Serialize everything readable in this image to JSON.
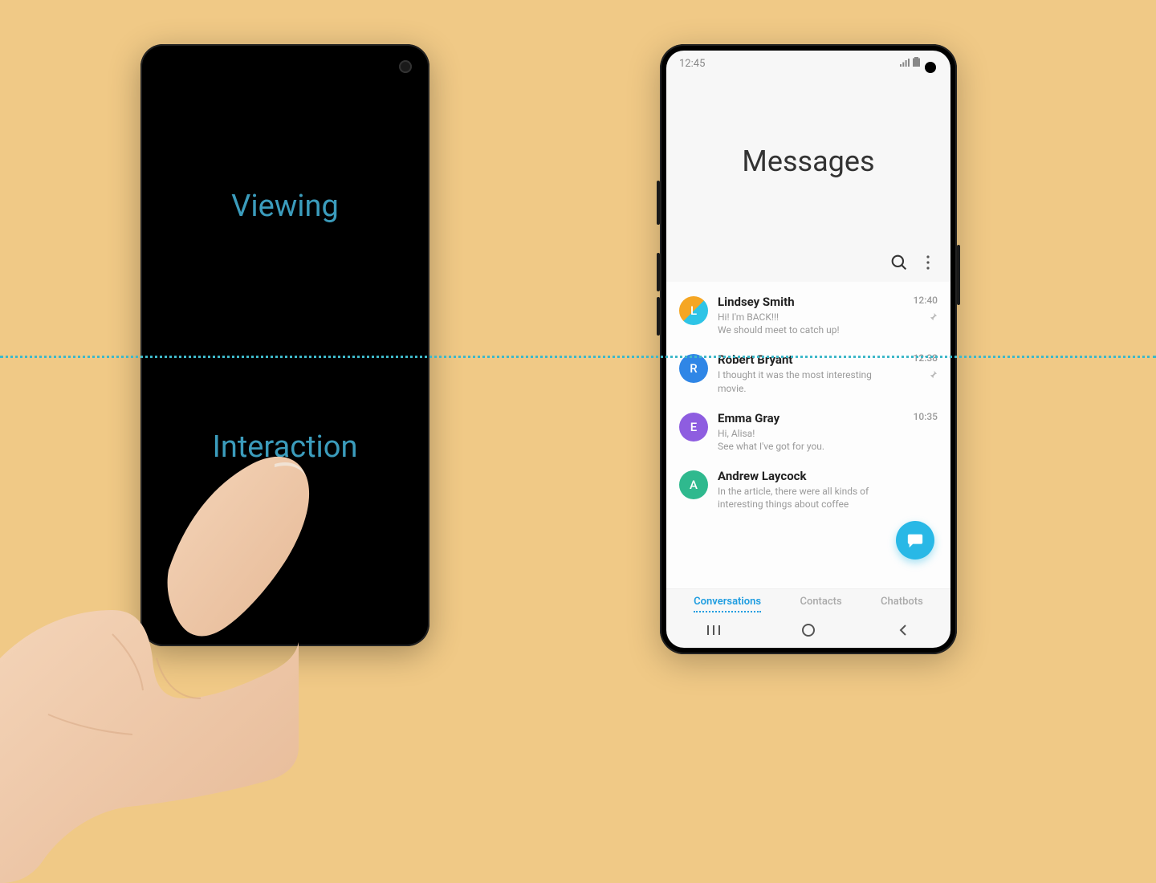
{
  "left_phone": {
    "viewing_label": "Viewing",
    "interaction_label": "Interaction"
  },
  "right_phone": {
    "status": {
      "time": "12:45"
    },
    "header": {
      "title": "Messages"
    },
    "conversations": [
      {
        "name": "Lindsey Smith",
        "preview_line1": "Hi! I'm BACK!!!",
        "preview_line2": "We should meet to catch up!",
        "time": "12:40",
        "pinned": true,
        "avatar_letter": "L",
        "avatar_class": "av-l"
      },
      {
        "name": "Robert Bryant",
        "preview_line1": "I thought it was the most interesting",
        "preview_line2": "movie.",
        "time": "12:38",
        "pinned": true,
        "avatar_letter": "R",
        "avatar_class": "av-r"
      },
      {
        "name": "Emma Gray",
        "preview_line1": "Hi, Alisa!",
        "preview_line2": "See what I've got for you.",
        "time": "10:35",
        "pinned": false,
        "avatar_letter": "E",
        "avatar_class": "av-e"
      },
      {
        "name": "Andrew Laycock",
        "preview_line1": "In the article, there were all kinds of",
        "preview_line2": "interesting things about coffee",
        "time": "",
        "pinned": false,
        "avatar_letter": "A",
        "avatar_class": "av-a"
      }
    ],
    "tabs": {
      "active": "Conversations",
      "second": "Contacts",
      "third": "Chatbots"
    }
  }
}
